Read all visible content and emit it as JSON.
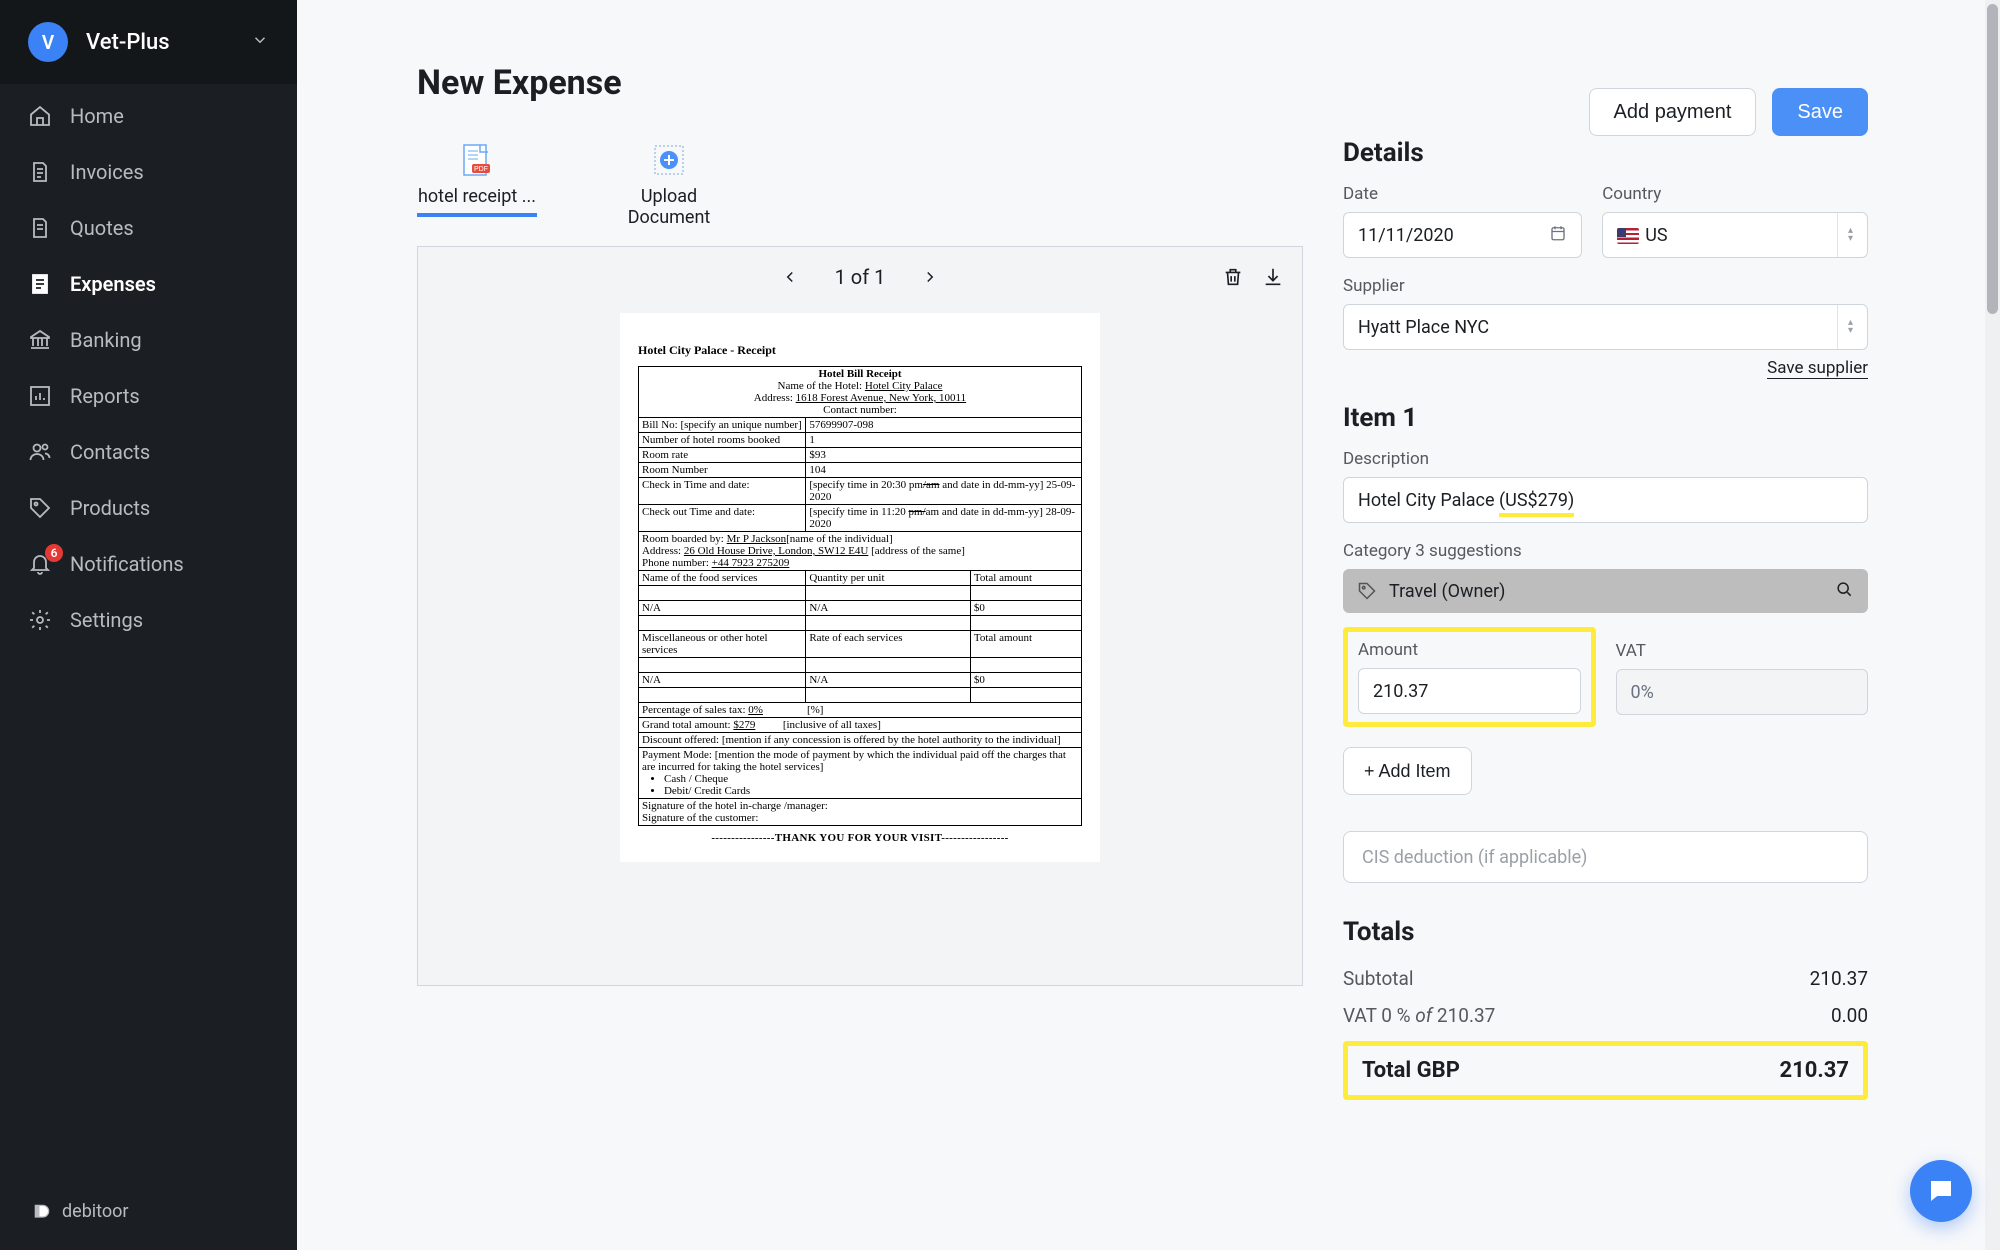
{
  "org": {
    "initial": "V",
    "name": "Vet-Plus"
  },
  "nav": {
    "home": "Home",
    "invoices": "Invoices",
    "quotes": "Quotes",
    "expenses": "Expenses",
    "banking": "Banking",
    "reports": "Reports",
    "contacts": "Contacts",
    "products": "Products",
    "notifications": "Notifications",
    "notifications_badge": "6",
    "settings": "Settings"
  },
  "footer_brand": "debitoor",
  "page": {
    "title": "New Expense",
    "add_payment": "Add payment",
    "save": "Save"
  },
  "docs": {
    "attached_name": "hotel receipt ...",
    "upload_l1": "Upload",
    "upload_l2": "Document",
    "page_counter": "1 of 1"
  },
  "receipt": {
    "header": "Hotel City Palace - Receipt",
    "title": "Hotel Bill Receipt",
    "name_of_hotel_label": "Name of the Hotel: ",
    "name_of_hotel": "Hotel City Palace",
    "address_label": "Address: ",
    "address": "1618  Forest Avenue, New York, 10011",
    "contact_label": "Contact number:",
    "bill_no_label": "Bill No: [specify an unique number]",
    "bill_no": "57699907-098",
    "rooms_label": "Number of hotel rooms booked",
    "rooms": "1",
    "rate_label": "Room rate",
    "rate": "$93",
    "room_no_label": "Room Number",
    "room_no": "104",
    "checkin_label": "Check in Time and date:",
    "checkin": "[specify time in 20:30 pm/am and date in dd-mm-yy] 25-09-2020",
    "checkout_label": "Check out Time and date:",
    "checkout": "[specify time in 11:20 pm/am and date in dd-mm-yy] 28-09-2020",
    "boarded_label": "Room boarded by: ",
    "boarded_name": "Mr P Jackson",
    "boarded_suffix": "[name of the individual]",
    "addr2_label": "Address: ",
    "addr2": "26 Old House Drive, London, SW12 E4U",
    "addr2_suffix": " [address of the same]",
    "phone_label": "Phone number: ",
    "phone": "+44 7923 275209",
    "svc_h1": "Name of the food services",
    "svc_h2": "Quantity per unit",
    "svc_h3": "Total amount",
    "na": "N/A",
    "dollar0": "$0",
    "misc_label": "Miscellaneous or other hotel services",
    "rate_each": "Rate of each services",
    "grand_total_label": "Grand total amount: ",
    "grand_total": "$279",
    "grand_total_suffix": "          [inclusive of all taxes]",
    "sales_tax_label": "Percentage of sales tax: ",
    "sales_tax": "0%",
    "sales_tax_suffix": "                [%]",
    "discount_label": "Discount offered:                        [mention if any concession is offered by the hotel authority to the individual]",
    "payment_label": "Payment Mode: [mention the mode of payment by which the individual paid off the charges that are incurred for taking the hotel services]",
    "pm1": "Cash / Cheque",
    "pm2": "Debit/ Credit Cards",
    "sig1": "Signature of the hotel in-charge /manager:",
    "sig2": "Signature of the customer:",
    "thank": "----------------THANK YOU FOR YOUR VISIT-----------------"
  },
  "details": {
    "heading": "Details",
    "date_label": "Date",
    "date": "11/11/2020",
    "country_label": "Country",
    "country": "US",
    "supplier_label": "Supplier",
    "supplier": "Hyatt Place NYC",
    "save_supplier": "Save supplier"
  },
  "item": {
    "heading": "Item 1",
    "description_label": "Description",
    "description_prefix": "Hotel City Palace ",
    "description_hl": "(US$279)",
    "category_label": "Category 3 suggestions",
    "category": "Travel (Owner)",
    "amount_label": "Amount",
    "amount": "210.37",
    "vat_label": "VAT",
    "vat": "0%",
    "add_item": "+ Add Item"
  },
  "cis": {
    "placeholder": "CIS deduction (if applicable)"
  },
  "totals": {
    "heading": "Totals",
    "subtotal_label": "Subtotal",
    "subtotal": "210.37",
    "vat_line_prefix": "VAT 0 % ",
    "vat_line_of": "of",
    "vat_line_base": "  210.37",
    "vat_value": "0.00",
    "total_label": "Total GBP",
    "total_value": "210.37"
  }
}
